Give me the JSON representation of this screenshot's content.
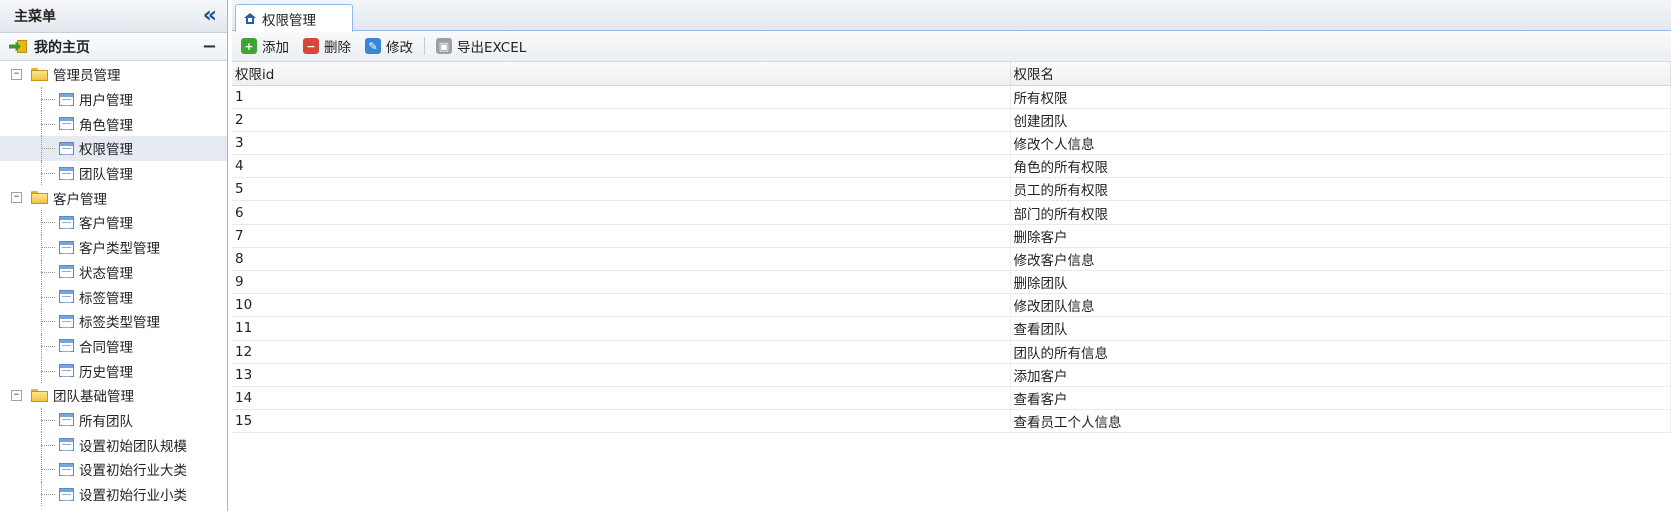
{
  "sidebar": {
    "title": "主菜单",
    "collapse_glyph": "«",
    "panel_title": "我的主页",
    "panel_toggle": "−",
    "tree": [
      {
        "type": "group",
        "label": "管理员管理",
        "toggle": "−"
      },
      {
        "type": "leaf",
        "label": "用户管理"
      },
      {
        "type": "leaf",
        "label": "角色管理"
      },
      {
        "type": "leaf",
        "label": "权限管理",
        "selected": true
      },
      {
        "type": "leaf",
        "label": "团队管理"
      },
      {
        "type": "group",
        "label": "客户管理",
        "toggle": "−"
      },
      {
        "type": "leaf",
        "label": "客户管理"
      },
      {
        "type": "leaf",
        "label": "客户类型管理"
      },
      {
        "type": "leaf",
        "label": "状态管理"
      },
      {
        "type": "leaf",
        "label": "标签管理"
      },
      {
        "type": "leaf",
        "label": "标签类型管理"
      },
      {
        "type": "leaf",
        "label": "合同管理"
      },
      {
        "type": "leaf",
        "label": "历史管理"
      },
      {
        "type": "group",
        "label": "团队基础管理",
        "toggle": "−"
      },
      {
        "type": "leaf",
        "label": "所有团队"
      },
      {
        "type": "leaf",
        "label": "设置初始团队规模"
      },
      {
        "type": "leaf",
        "label": "设置初始行业大类"
      },
      {
        "type": "leaf",
        "label": "设置初始行业小类"
      }
    ]
  },
  "tabs": [
    {
      "label": "权限管理"
    }
  ],
  "toolbar": {
    "add_label": "添加",
    "delete_label": "删除",
    "edit_label": "修改",
    "export_label": "导出EXCEL"
  },
  "grid": {
    "columns": [
      "权限id",
      "权限名"
    ],
    "rows": [
      [
        "1",
        "所有权限"
      ],
      [
        "2",
        "创建团队"
      ],
      [
        "3",
        "修改个人信息"
      ],
      [
        "4",
        "角色的所有权限"
      ],
      [
        "5",
        "员工的所有权限"
      ],
      [
        "6",
        "部门的所有权限"
      ],
      [
        "7",
        "删除客户"
      ],
      [
        "8",
        "修改客户信息"
      ],
      [
        "9",
        "删除团队"
      ],
      [
        "10",
        "修改团队信息"
      ],
      [
        "11",
        "查看团队"
      ],
      [
        "12",
        "团队的所有信息"
      ],
      [
        "13",
        "添加客户"
      ],
      [
        "14",
        "查看客户"
      ],
      [
        "15",
        "查看员工个人信息"
      ]
    ]
  },
  "colors": {
    "accent_border": "#95b8e7",
    "selected_row": "#e6ebf2"
  }
}
